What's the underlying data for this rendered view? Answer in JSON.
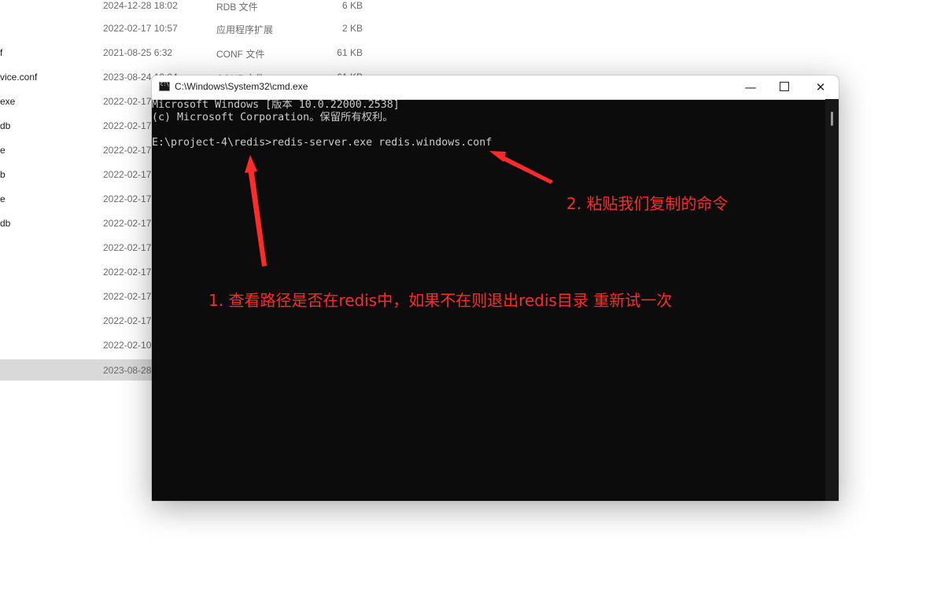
{
  "explorer": {
    "rows": [
      {
        "name": "",
        "date": "2024-12-28 18:02",
        "type": "RDB 文件",
        "size": "6 KB"
      },
      {
        "name": "",
        "date": "2022-02-17 10:57",
        "type": "应用程序扩展",
        "size": "2 KB"
      },
      {
        "name": "f",
        "date": "2021-08-25 6:32",
        "type": "CONF 文件",
        "size": "61 KB"
      },
      {
        "name": "vice.conf",
        "date": "2023-08-24 10:04",
        "type": "CONF 文件",
        "size": "61 KB"
      },
      {
        "name": "exe",
        "date": "2022-02-17",
        "type": "",
        "size": ""
      },
      {
        "name": "db",
        "date": "2022-02-17",
        "type": "",
        "size": ""
      },
      {
        "name": "e",
        "date": "2022-02-17",
        "type": "",
        "size": ""
      },
      {
        "name": "b",
        "date": "2022-02-17",
        "type": "",
        "size": ""
      },
      {
        "name": "e",
        "date": "2022-02-17",
        "type": "",
        "size": ""
      },
      {
        "name": "db",
        "date": "2022-02-17",
        "type": "",
        "size": ""
      },
      {
        "name": "",
        "date": "2022-02-17",
        "type": "",
        "size": ""
      },
      {
        "name": "",
        "date": "2022-02-17",
        "type": "",
        "size": ""
      },
      {
        "name": "",
        "date": "2022-02-17",
        "type": "",
        "size": ""
      },
      {
        "name": "",
        "date": "2022-02-17",
        "type": "",
        "size": ""
      },
      {
        "name": "",
        "date": "2022-02-10",
        "type": "",
        "size": ""
      },
      {
        "name": "",
        "date": "2023-08-28",
        "type": "",
        "size": ""
      }
    ]
  },
  "cmd": {
    "title": "C:\\Windows\\System32\\cmd.exe",
    "minimize": "—",
    "close": "✕",
    "lines": [
      "Microsoft Windows [版本 10.0.22000.2538]",
      "(c) Microsoft Corporation。保留所有权利。",
      "",
      "E:\\project-4\\redis>redis-server.exe redis.windows.conf"
    ]
  },
  "annotations": {
    "note1": "1. 查看路径是否在redis中，如果不在则退出redis目录 重新试一次",
    "note2": "2. 粘贴我们复制的命令",
    "color": "#ff2b2b"
  }
}
